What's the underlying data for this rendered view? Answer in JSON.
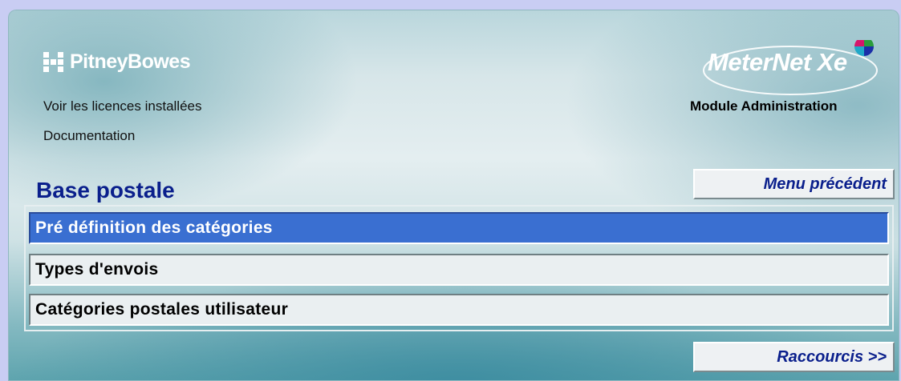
{
  "brand": {
    "name": "PitneyBowes"
  },
  "product": {
    "name": "MeterNet Xe",
    "module": "Module Administration"
  },
  "links": [
    "Voir les licences installées",
    "Documentation"
  ],
  "section": {
    "title": "Base postale"
  },
  "buttons": {
    "back": "Menu précédent",
    "shortcuts": "Raccourcis >>"
  },
  "menu": {
    "selected_index": 0,
    "items": [
      {
        "label": "Pré définition des catégories"
      },
      {
        "label": "Types d'envois"
      },
      {
        "label": "Catégories postales utilisateur"
      }
    ]
  },
  "colors": {
    "accent": "#0a1f8c",
    "selection": "#3a6fd1",
    "page_bg": "#c9cdf3"
  }
}
